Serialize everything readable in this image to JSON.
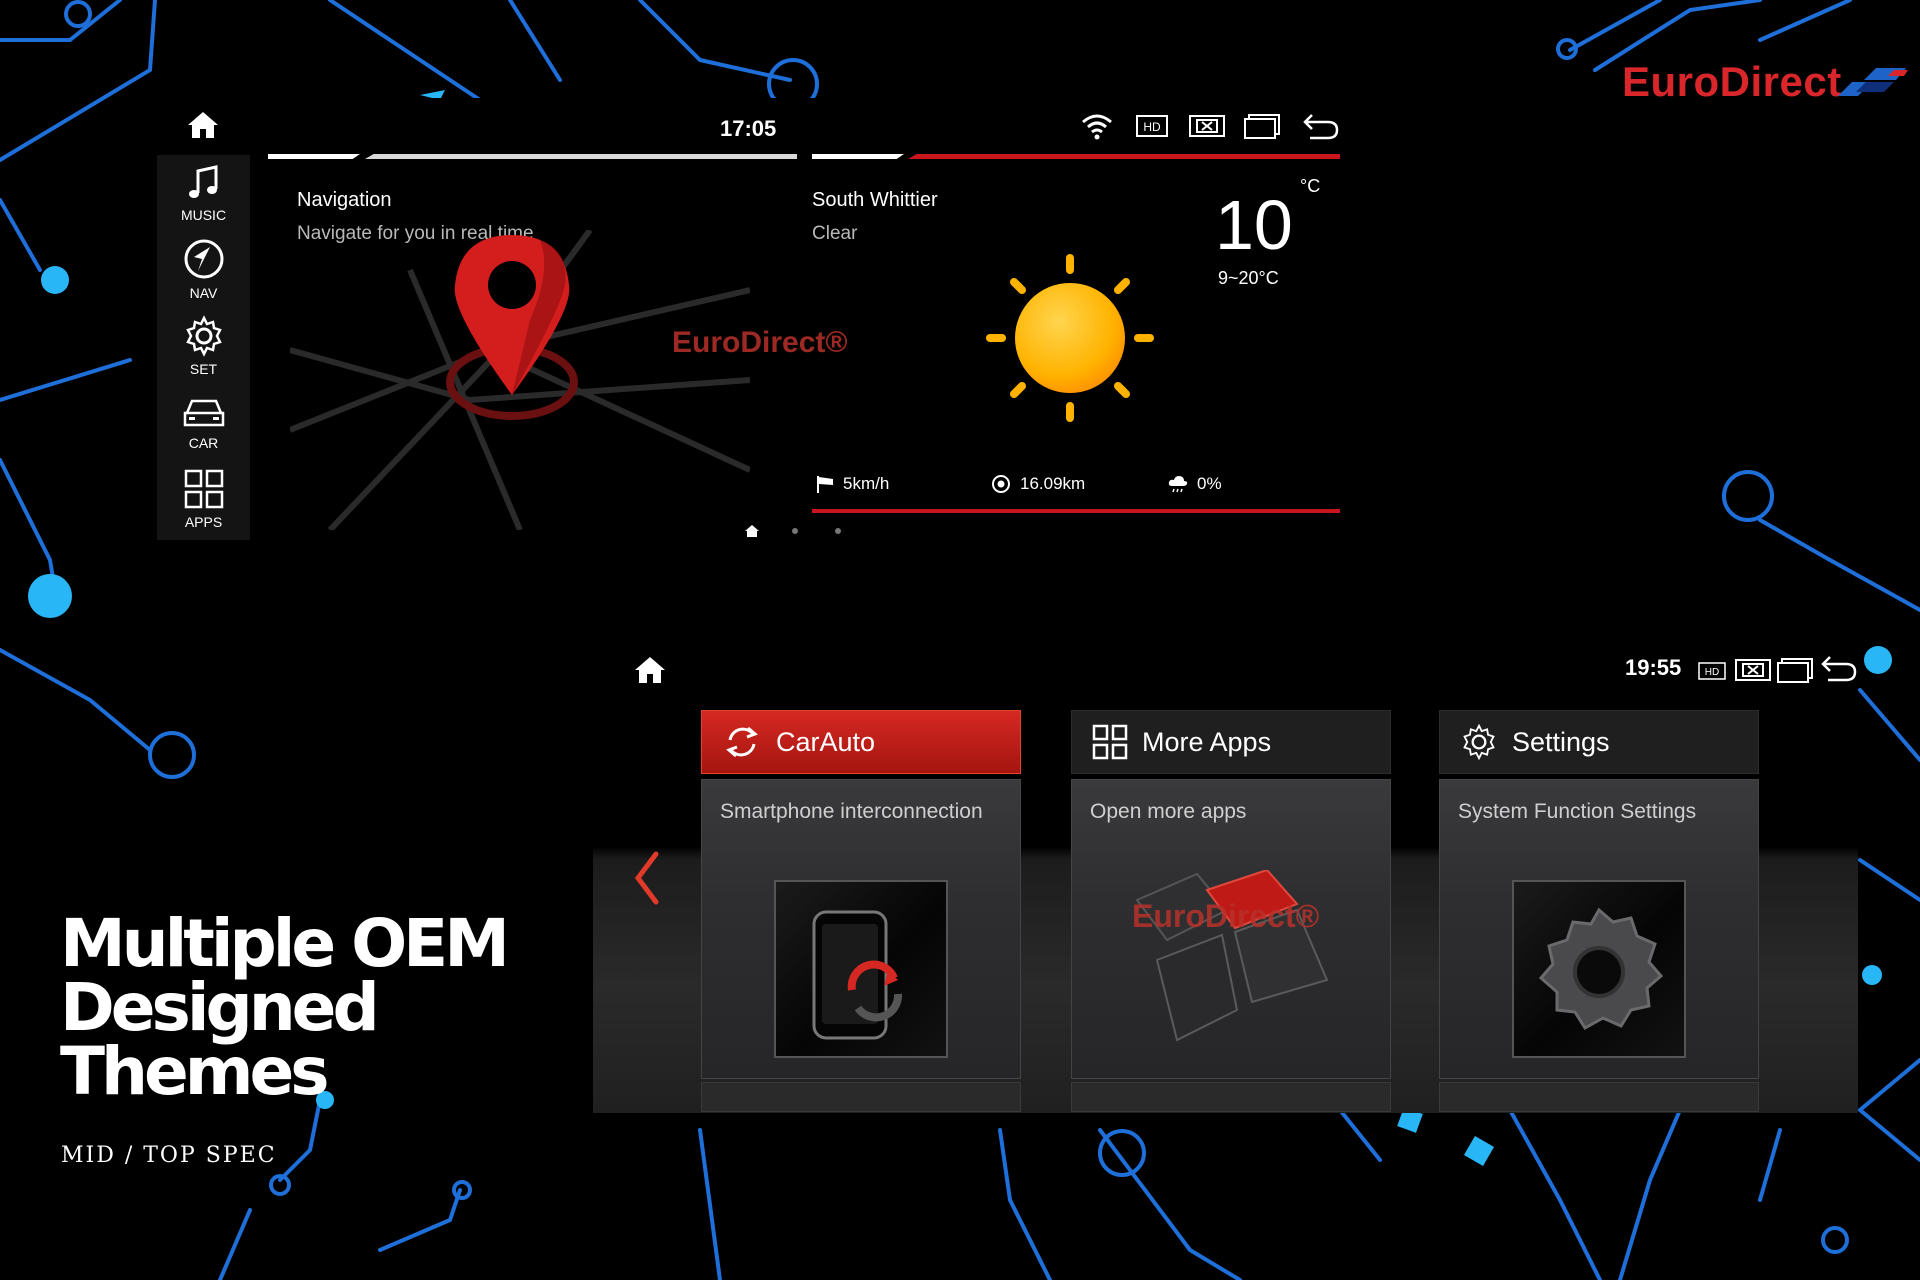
{
  "brand": {
    "name": "EuroDirect",
    "color": "#d8262b"
  },
  "screen1": {
    "time": "17:05",
    "dock": [
      {
        "label": "MUSIC",
        "icon": "music-note-icon"
      },
      {
        "label": "NAV",
        "icon": "navigation-icon"
      },
      {
        "label": "SET",
        "icon": "gear-icon"
      },
      {
        "label": "CAR",
        "icon": "car-icon"
      },
      {
        "label": "APPS",
        "icon": "apps-grid-icon"
      }
    ],
    "status_icons": [
      "wifi-icon",
      "hd-icon",
      "close-box-icon",
      "window-icon",
      "back-icon"
    ],
    "navigation_card": {
      "title": "Navigation",
      "subtitle": "Navigate for you in real time",
      "watermark": "EuroDirect®"
    },
    "weather_card": {
      "location": "South Whittier",
      "condition": "Clear",
      "temperature": "10",
      "unit": "°C",
      "range": "9~20°C",
      "wind": "5km/h",
      "visibility": "16.09km",
      "precipitation": "0%"
    },
    "page_indicator": {
      "pages": 3,
      "active": 0
    }
  },
  "screen2": {
    "time": "19:55",
    "status_icons": [
      "hd-icon",
      "close-box-icon",
      "window-icon",
      "back-icon"
    ],
    "tiles": [
      {
        "title": "CarAuto",
        "description": "Smartphone interconnection",
        "active": true,
        "icon": "refresh-icon"
      },
      {
        "title": "More Apps",
        "description": "Open more apps",
        "active": false,
        "icon": "apps-grid-icon"
      },
      {
        "title": "Settings",
        "description": "System Function Settings",
        "active": false,
        "icon": "gear-icon"
      }
    ],
    "watermark": "EuroDirect®"
  },
  "caption": {
    "headline_lines": [
      "Multiple OEM",
      "Designed",
      "Themes"
    ],
    "subline": "MID / TOP SPEC"
  },
  "colors": {
    "accent_red": "#d52822",
    "circuit_blue": "#1e88e5",
    "circuit_glow": "#29b6f6"
  }
}
